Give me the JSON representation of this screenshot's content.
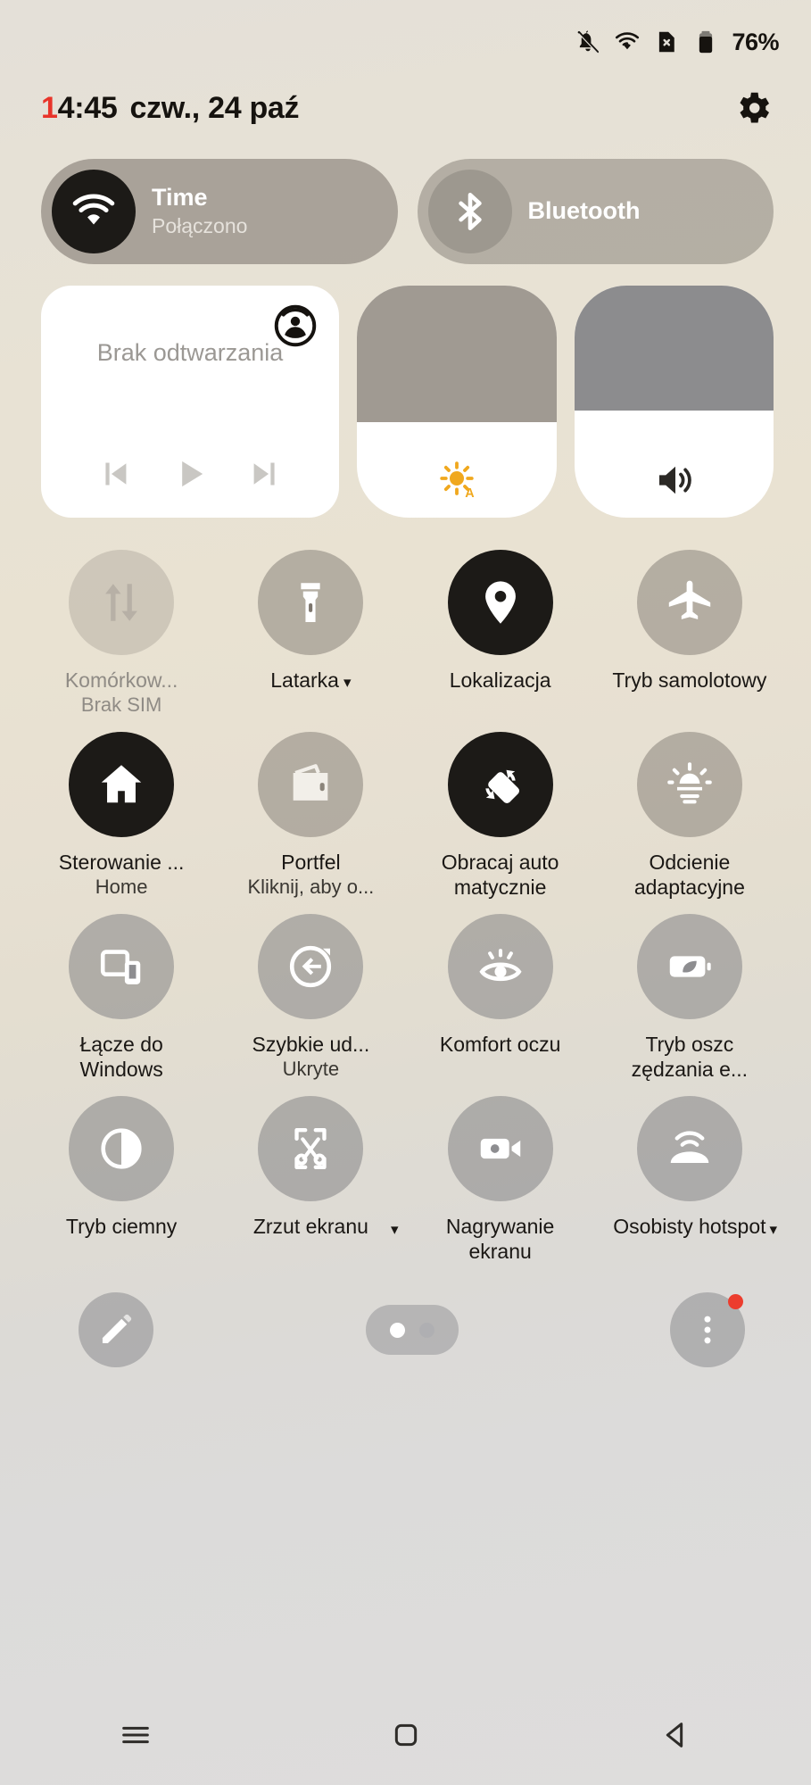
{
  "statusbar": {
    "icons": [
      "bell-muted-icon",
      "wifi-icon",
      "sim-card-off-icon",
      "battery-icon"
    ],
    "battery_percent": "76%"
  },
  "header": {
    "time_highlight": "1",
    "time_rest": "4:45",
    "date": "czw., 24 paź",
    "settings_icon": "gear-icon"
  },
  "connectivity": [
    {
      "id": "wifi",
      "icon": "wifi-icon",
      "title": "Time",
      "subtitle": "Połączono",
      "active": true
    },
    {
      "id": "bluetooth",
      "icon": "bluetooth-icon",
      "title": "Bluetooth",
      "subtitle": "",
      "active": false
    }
  ],
  "media": {
    "cast_icon": "cast-icon",
    "title": "Brak odtwarzania",
    "controls": [
      "previous-icon",
      "play-icon",
      "next-icon"
    ]
  },
  "sliders": [
    {
      "id": "brightness",
      "icon": "brightness-auto-icon",
      "value": 41,
      "auto_label": "A"
    },
    {
      "id": "volume",
      "icon": "volume-icon",
      "value": 46
    }
  ],
  "tiles": [
    {
      "icon": "mobile-data-icon",
      "label": "Komórkow...",
      "sublabel": "Brak SIM",
      "state": "disabled"
    },
    {
      "icon": "flashlight-icon",
      "label": "Latarka",
      "sublabel": "",
      "state": "off",
      "caret": true
    },
    {
      "icon": "location-icon",
      "label": "Lokalizacja",
      "sublabel": "",
      "state": "on"
    },
    {
      "icon": "airplane-icon",
      "label": "Tryb samolotowy",
      "sublabel": "",
      "state": "off"
    },
    {
      "icon": "home-icon",
      "label": "Sterowanie ...",
      "sublabel": "Home",
      "state": "on"
    },
    {
      "icon": "wallet-icon",
      "label": "Portfel",
      "sublabel": "Kliknij, aby o...",
      "state": "off"
    },
    {
      "icon": "auto-rotate-icon",
      "label": "Obracaj auto matycznie",
      "sublabel": "",
      "state": "on"
    },
    {
      "icon": "adaptive-brightness-icon",
      "label": "Odcienie adaptacyjne",
      "sublabel": "",
      "state": "off"
    },
    {
      "icon": "link-to-windows-icon",
      "label": "Łącze do Windows",
      "sublabel": "",
      "state": "off2"
    },
    {
      "icon": "quick-share-icon",
      "label": "Szybkie ud...",
      "sublabel": "Ukryte",
      "state": "off2"
    },
    {
      "icon": "eye-comfort-icon",
      "label": "Komfort oczu",
      "sublabel": "",
      "state": "off2"
    },
    {
      "icon": "power-saving-icon",
      "label": "Tryb oszc zędzania e...",
      "sublabel": "",
      "state": "off2"
    },
    {
      "icon": "dark-mode-icon",
      "label": "Tryb ciemny",
      "sublabel": "",
      "state": "off2"
    },
    {
      "icon": "screenshot-icon",
      "label": "Zrzut ekranu",
      "sublabel": "",
      "state": "off2",
      "caret_side": true
    },
    {
      "icon": "screen-recorder-icon",
      "label": "Nagrywanie ekranu",
      "sublabel": "",
      "state": "off2"
    },
    {
      "icon": "hotspot-icon",
      "label": "Osobisty hotspot",
      "sublabel": "",
      "state": "off2",
      "caret_side": true
    }
  ],
  "bottom": {
    "edit_icon": "pencil-icon",
    "pages": {
      "count": 2,
      "active": 0
    },
    "menu_icon": "more-vertical-icon",
    "menu_badge": true
  },
  "navbar": {
    "recents_icon": "recents-icon",
    "home_icon": "home-square-icon",
    "back_icon": "back-triangle-icon"
  },
  "colors": {
    "accent_red": "#e8342a",
    "tile_on": "#1c1a17",
    "badge": "#ec3d2e"
  }
}
